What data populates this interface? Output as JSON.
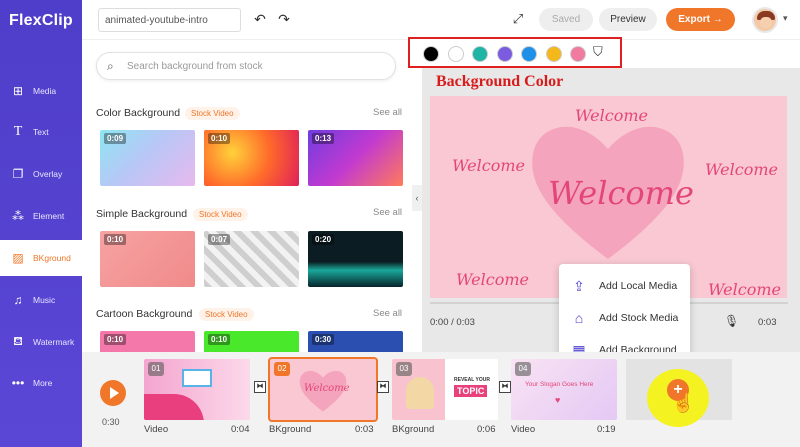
{
  "app": {
    "logo": "FlexClip"
  },
  "sidebar": {
    "items": [
      {
        "label": "Media",
        "icon": "media-icon"
      },
      {
        "label": "Text",
        "icon": "text-icon"
      },
      {
        "label": "Overlay",
        "icon": "overlay-icon"
      },
      {
        "label": "Element",
        "icon": "element-icon"
      },
      {
        "label": "BKground",
        "icon": "background-icon",
        "active": true
      },
      {
        "label": "Music",
        "icon": "music-icon"
      },
      {
        "label": "Watermark",
        "icon": "watermark-icon"
      },
      {
        "label": "More",
        "icon": "more-icon"
      }
    ]
  },
  "topbar": {
    "project_name": "animated-youtube-intro",
    "saved_label": "Saved",
    "preview_label": "Preview",
    "export_label": "Export →"
  },
  "panel": {
    "search_placeholder": "Search background from stock",
    "see_all": "See all",
    "sections": [
      {
        "title": "Color Background",
        "badge": "Stock Video",
        "durations": [
          "0:09",
          "0:10",
          "0:13"
        ]
      },
      {
        "title": "Simple Background",
        "badge": "Stock Video",
        "durations": [
          "0:10",
          "0:07",
          "0:20"
        ]
      },
      {
        "title": "Cartoon Background",
        "badge": "Stock Video",
        "durations": [
          "0:10",
          "0:10",
          "0:30"
        ]
      }
    ]
  },
  "colors": {
    "swatches": [
      "#000000",
      "#ffffff",
      "#1fb5a6",
      "#7b5ce0",
      "#1e90e8",
      "#f5b81c",
      "#f07aa0"
    ],
    "accent": "#f0762a",
    "sidebar": "#4e3ec9"
  },
  "canvas": {
    "annotation": "Background Color",
    "main_text": "Welcome",
    "small_text": "Welcome",
    "time_current": "0:00 / 0:03",
    "time_end": "0:03"
  },
  "menu": {
    "items": [
      {
        "label": "Add Local Media",
        "icon": "upload-icon"
      },
      {
        "label": "Add Stock Media",
        "icon": "store-icon"
      },
      {
        "label": "Add Background",
        "icon": "background-add-icon"
      }
    ]
  },
  "timeline": {
    "total": "0:30",
    "clips": [
      {
        "num": "01",
        "type": "Video",
        "duration": "0:04"
      },
      {
        "num": "02",
        "type": "BKground",
        "duration": "0:03",
        "selected": true
      },
      {
        "num": "03",
        "type": "BKground",
        "duration": "0:06",
        "topic_top": "REVEAL YOUR",
        "topic_main": "TOPIC"
      },
      {
        "num": "04",
        "type": "Video",
        "duration": "0:19",
        "slogan": "Your Slogan Goes Here"
      }
    ],
    "clip2_text": "Welcome"
  }
}
